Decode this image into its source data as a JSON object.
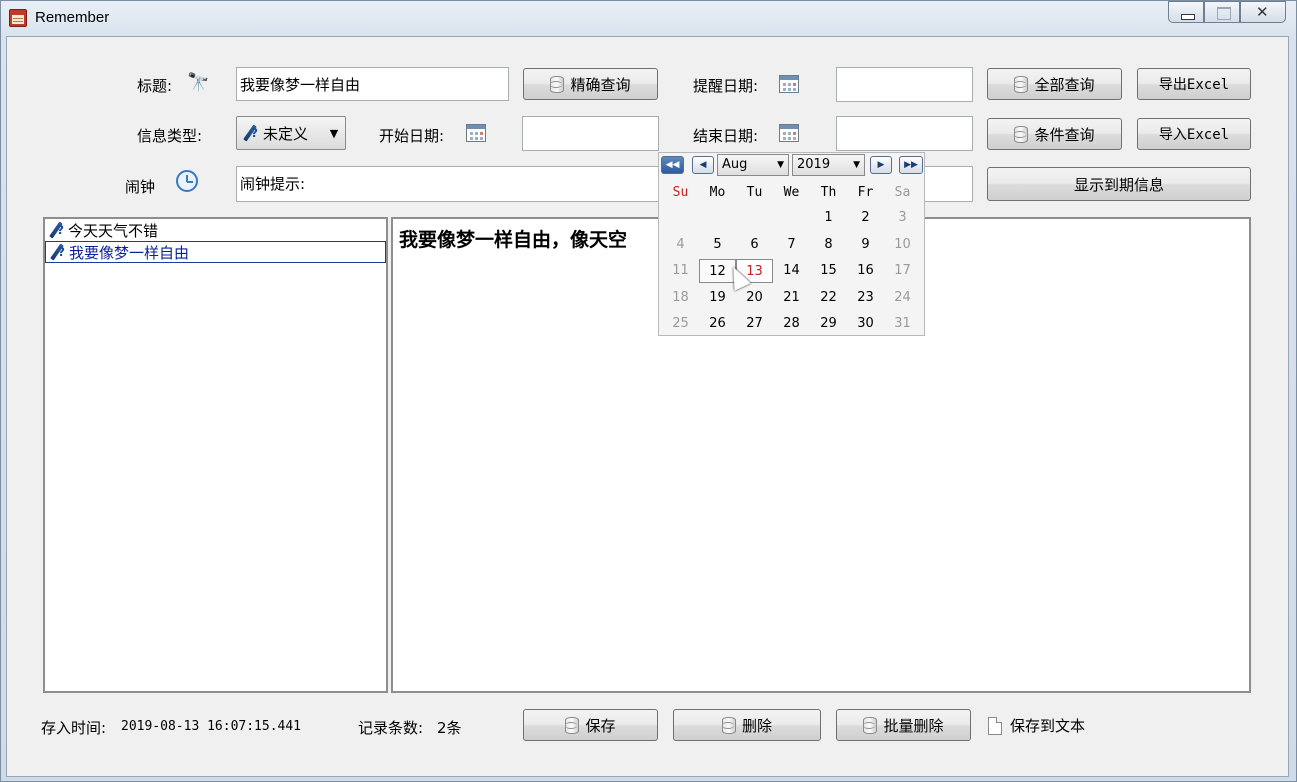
{
  "window": {
    "title": "Remember"
  },
  "form": {
    "title_label": "标题:",
    "title_value": "我要像梦一样自由",
    "exact_query_label": "精确查询",
    "remind_date_label": "提醒日期:",
    "remind_date_value": "",
    "all_query_label": "全部查询",
    "export_excel_label": "导出Excel",
    "info_type_label": "信息类型:",
    "info_type_value": "未定义",
    "start_date_label": "开始日期:",
    "start_date_value": "",
    "end_date_label": "结束日期:",
    "end_date_value": "",
    "condition_query_label": "条件查询",
    "import_excel_label": "导入Excel",
    "alarm_label": "闹钟",
    "alarm_hint_value": "闹钟提示:",
    "show_expired_label": "显示到期信息"
  },
  "list": {
    "items": [
      {
        "label": "今天天气不错",
        "selected": false
      },
      {
        "label": "我要像梦一样自由",
        "selected": true
      }
    ]
  },
  "content": {
    "text": "我要像梦一样自由，像天空"
  },
  "footer": {
    "saved_time_label": "存入时间:",
    "saved_time_value": "2019-08-13 16:07:15.441",
    "record_count_label": "记录条数:",
    "record_count_value": "2条",
    "save_label": "保存",
    "delete_label": "删除",
    "batch_delete_label": "批量删除",
    "save_to_text_label": "保存到文本"
  },
  "calendar": {
    "month": "Aug",
    "year": "2019",
    "weekdays": [
      "Su",
      "Mo",
      "Tu",
      "We",
      "Th",
      "Fr",
      "Sa"
    ],
    "weekday_colors": {
      "sunday": "#c62020"
    },
    "weeks": [
      [
        "",
        "",
        "",
        "",
        "1",
        "2",
        "3"
      ],
      [
        "4",
        "5",
        "6",
        "7",
        "8",
        "9",
        "10"
      ],
      [
        "11",
        "12",
        "13",
        "14",
        "15",
        "16",
        "17"
      ],
      [
        "18",
        "19",
        "20",
        "21",
        "22",
        "23",
        "24"
      ],
      [
        "25",
        "26",
        "27",
        "28",
        "29",
        "30",
        "31"
      ]
    ],
    "today": "12",
    "selected": "13"
  }
}
